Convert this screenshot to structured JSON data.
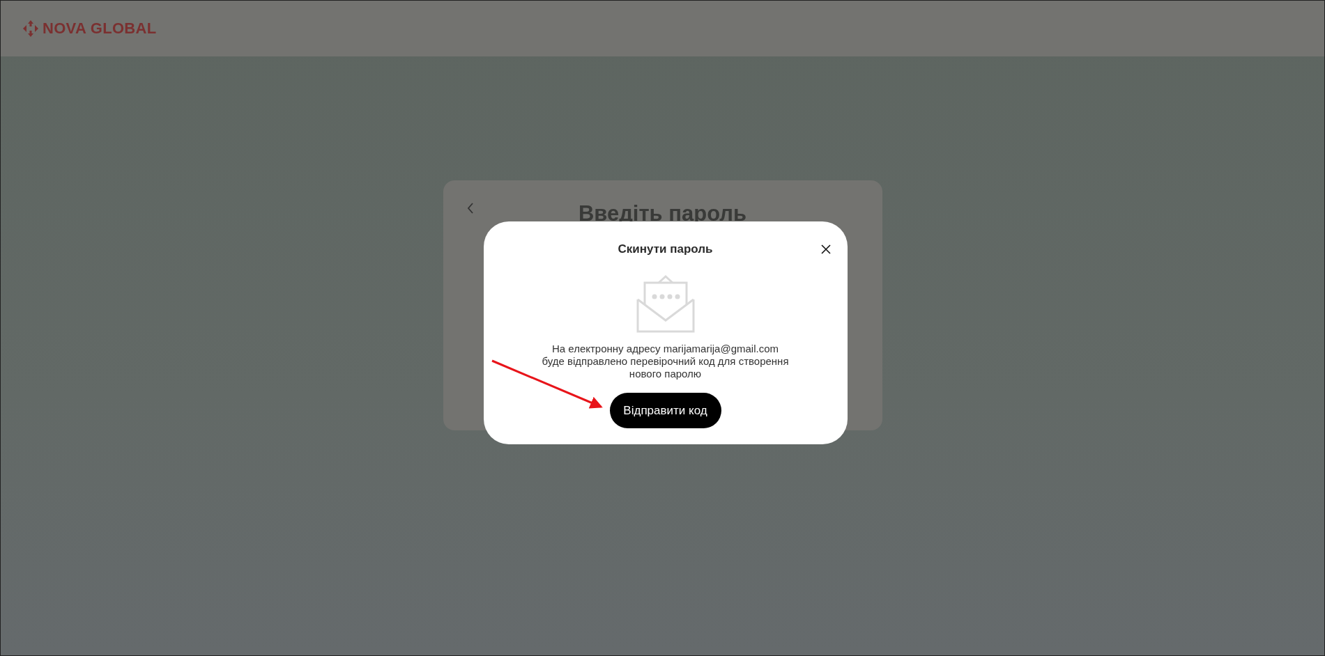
{
  "header": {
    "logo": "NOVA GLOBAL"
  },
  "background_card": {
    "title": "Введіть пароль"
  },
  "dialog": {
    "title": "Скинути пароль",
    "message": "На електронну адресу marijamarija@gmail.com\nбуде відправлено перевірочний код для створення\nнового паролю",
    "button": "Відправити код"
  }
}
